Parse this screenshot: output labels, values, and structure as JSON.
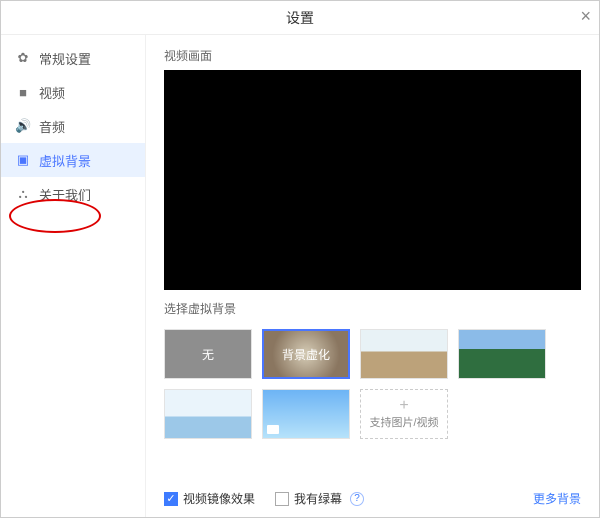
{
  "window": {
    "title": "设置"
  },
  "sidebar": {
    "items": [
      {
        "label": "常规设置",
        "icon": "gear"
      },
      {
        "label": "视频",
        "icon": "video"
      },
      {
        "label": "音频",
        "icon": "audio"
      },
      {
        "label": "虚拟背景",
        "icon": "user-card",
        "active": true
      },
      {
        "label": "关于我们",
        "icon": "about"
      }
    ]
  },
  "main": {
    "preview_label": "视频画面",
    "choose_label": "选择虚拟背景",
    "thumbs": {
      "none": "无",
      "blur": "背景虚化",
      "add_plus": "+",
      "add_label": "支持图片/视频"
    },
    "mirror_label": "视频镜像效果",
    "mirror_checked": true,
    "greenscreen_label": "我有绿幕",
    "greenscreen_checked": false,
    "help": "?",
    "more_link": "更多背景"
  }
}
